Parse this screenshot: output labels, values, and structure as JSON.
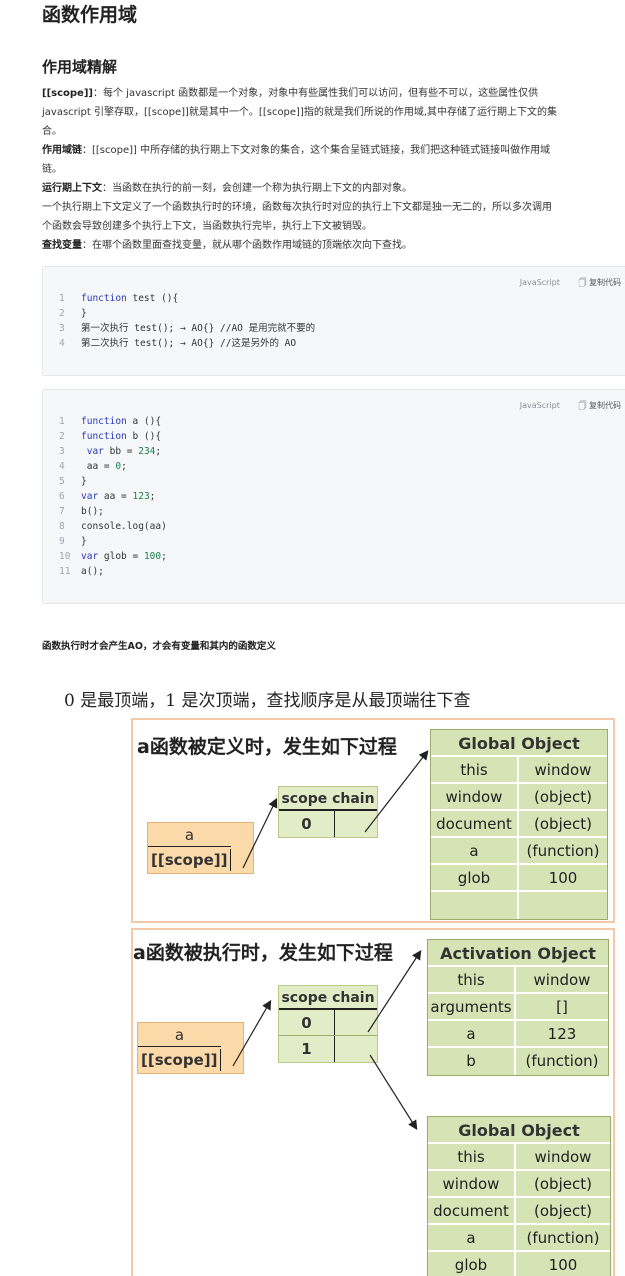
{
  "page_title": "函数作用域",
  "section_title": "作用域精解",
  "paragraphs": {
    "scope_term": "[[scope]]",
    "scope_desc_1": "：每个 javascript 函数都是一个对象，对象中有些属性我们可以访问，但有些不可以，这些属性仅供",
    "scope_desc_2": "javascript 引擎存取，[[scope]]就是其中一个。[[scope]]指的就是我们所说的作用域,其中存储了运行期上下文的集",
    "scope_desc_3": "合。",
    "chain_term": "作用域链",
    "chain_desc_1": "：[[scope]] 中所存储的执行期上下文对象的集合，这个集合呈链式链接，我们把这种链式链接叫做作用域",
    "chain_desc_2": "链。",
    "context_term": "运行期上下文",
    "context_desc": "：当函数在执行的前一刻，会创建一个称为执行期上下文的内部对象。",
    "context_more_1": "一个执行期上下文定义了一个函数执行时的环境，函数每次执行时对应的执行上下文都是独一无二的，所以多次调用",
    "context_more_2": "个函数会导致创建多个执行上下文，当函数执行完毕，执行上下文被销毁。",
    "lookup_term": "查找变量",
    "lookup_desc": "：在哪个函数里面查找变量，就从哪个函数作用域链的顶端依次向下查找。"
  },
  "code_toolbar": {
    "language": "JavaScript",
    "copy_label": "复制代码"
  },
  "code_block_1": [
    {
      "n": "1",
      "text": "function test (){"
    },
    {
      "n": "2",
      "text": "}"
    },
    {
      "n": "3",
      "text": "第一次执行 test(); → AO{} //AO 是用完就不要的"
    },
    {
      "n": "4",
      "text": "第二次执行 test(); → AO{} //这是另外的 AO"
    }
  ],
  "code_block_2": [
    {
      "n": "1",
      "text": "function a (){"
    },
    {
      "n": "2",
      "text": "function b (){"
    },
    {
      "n": "3",
      "text": " var bb = 234;"
    },
    {
      "n": "4",
      "text": " aa = 0;"
    },
    {
      "n": "5",
      "text": "}"
    },
    {
      "n": "6",
      "text": "var aa = 123;"
    },
    {
      "n": "7",
      "text": "b();"
    },
    {
      "n": "8",
      "text": "console.log(aa)"
    },
    {
      "n": "9",
      "text": "}"
    },
    {
      "n": "10",
      "text": "var glob = 100;"
    },
    {
      "n": "11",
      "text": "a();"
    }
  ],
  "note": "函数执行时才会产生AO，才会有变量和其内的函数定义",
  "figure": {
    "caption": "0 是最顶端，1 是次顶端，查找顺序是从最顶端往下查",
    "panel1": {
      "title": "a函数被定义时，发生如下过程",
      "func_name": "a",
      "scope_label": "[[scope]]",
      "scope_chain_title": "scope chain",
      "scope_chain_rows": [
        "0"
      ],
      "global_object": {
        "title": "Global Object",
        "rows": [
          {
            "key": "this",
            "value": "window"
          },
          {
            "key": "window",
            "value": "(object)"
          },
          {
            "key": "document",
            "value": "(object)"
          },
          {
            "key": "a",
            "value": "(function)"
          },
          {
            "key": "glob",
            "value": "100"
          },
          {
            "key": "",
            "value": ""
          }
        ]
      }
    },
    "panel2": {
      "title": "a函数被执行时，发生如下过程",
      "func_name": "a",
      "scope_label": "[[scope]]",
      "scope_chain_title": "scope chain",
      "scope_chain_rows": [
        "0",
        "1"
      ],
      "activation_object": {
        "title": "Activation Object",
        "rows": [
          {
            "key": "this",
            "value": "window"
          },
          {
            "key": "arguments",
            "value": "[]"
          },
          {
            "key": "a",
            "value": "123"
          },
          {
            "key": "b",
            "value": "(function)"
          }
        ]
      },
      "global_object": {
        "title": "Global Object",
        "rows": [
          {
            "key": "this",
            "value": "window"
          },
          {
            "key": "window",
            "value": "(object)"
          },
          {
            "key": "document",
            "value": "(object)"
          },
          {
            "key": "a",
            "value": "(function)"
          },
          {
            "key": "glob",
            "value": "100"
          }
        ]
      }
    }
  }
}
